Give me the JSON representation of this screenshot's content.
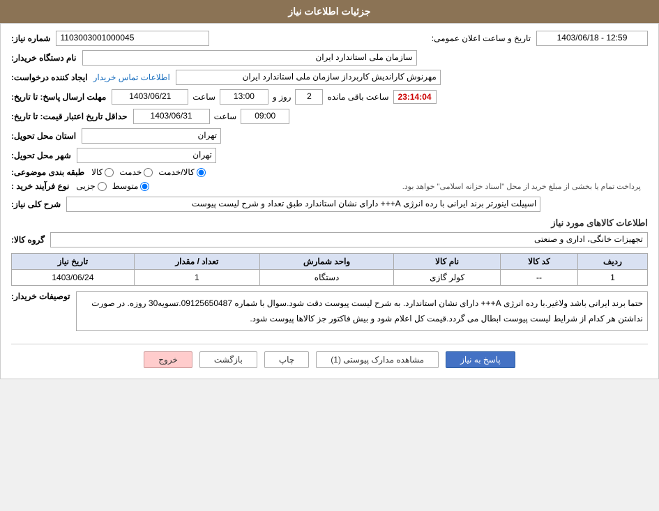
{
  "header": {
    "title": "جزئیات اطلاعات نیاز"
  },
  "form": {
    "shomareNiaz_label": "شماره نیاز:",
    "shomareNiaz_value": "1103003001000045",
    "namDastgah_label": "نام دستگاه خریدار:",
    "namDastgah_value": "سازمان ملی استاندارد ایران",
    "tarikhoSaat_label": "تاریخ و ساعت اعلان عمومی:",
    "tarikhoSaat_value": "1403/06/18 - 12:59",
    "ijadKonande_label": "ایجاد کننده درخواست:",
    "ijadKonande_value": "مهرنوش کاراندیش کاربرداز سازمان ملی استاندارد ایران",
    "ijadKonande_link": "اطلاعات تماس خریدار",
    "mohlatErsalLabel": "مهلت ارسال پاسخ: تا تاریخ:",
    "mohlatErsal_date": "1403/06/21",
    "mohlatErsal_saat_label": "ساعت",
    "mohlatErsal_saat": "13:00",
    "mohlatErsal_rooz_label": "روز و",
    "mohlatErsal_rooz": "2",
    "mohlatErsal_remaining_label": "ساعت باقی مانده",
    "mohlatErsal_timer": "23:14:04",
    "hadaqalTarikh_label": "حداقل تاریخ اعتبار قیمت: تا تاریخ:",
    "hadaqalTarikh_date": "1403/06/31",
    "hadaqalTarikh_saat_label": "ساعت",
    "hadaqalTarikh_saat": "09:00",
    "ostanLabel": "استان محل تحویل:",
    "ostan_value": "تهران",
    "shahrLabel": "شهر محل تحویل:",
    "shahr_value": "تهران",
    "tabaqebandiLabel": "طبقه بندی موضوعی:",
    "tabaqebandi_options": [
      {
        "label": "کالا",
        "value": "kala"
      },
      {
        "label": "خدمت",
        "value": "khedmat"
      },
      {
        "label": "کالا/خدمت",
        "value": "kala_khedmat",
        "selected": true
      }
    ],
    "noeFarayandLabel": "نوع فرآیند خرید :",
    "noeFarayand_options": [
      {
        "label": "جزیی",
        "value": "jozi"
      },
      {
        "label": "متوسط",
        "value": "motavaset",
        "selected": true
      }
    ],
    "noeFarayand_desc": "پرداخت تمام یا بخشی از مبلغ خرید از محل \"اسناد خزانه اسلامی\" خواهد بود.",
    "sharhKolli_label": "شرح کلی نیاز:",
    "sharhKolli_value": "اسپیلت اینورتر برند ایرانی با رده انرژی A+++ دارای نشان استاندارد طبق تعداد و شرح لیست پیوست",
    "ettelaatKalaLabel": "اطلاعات کالاهای مورد نیاز",
    "groupKalaLabel": "گروه کالا:",
    "groupKala_value": "تجهیزات خانگی، اداری و صنعتی",
    "table": {
      "columns": [
        "ردیف",
        "کد کالا",
        "نام کالا",
        "واحد شمارش",
        "تعداد / مقدار",
        "تاریخ نیاز"
      ],
      "rows": [
        {
          "radif": "1",
          "kodKala": "--",
          "namKala": "کولر گازی",
          "vahedShomareh": "دستگاه",
          "tedad": "1",
          "tarikh": "1403/06/24"
        }
      ]
    },
    "tosaifatLabel": "توصیفات خریدار:",
    "tosaifat_value": "حتما برند ایرانی باشد ولاغیر.با رده انرژی A+++ دارای نشان استاندارد. به شرح لیست پیوست دقت شود.سوال با شماره 09125650487.تسویه30 روزه. در صورت نداشتن هر کدام از شرایط لیست پیوست ابطال می گردد.قیمت کل اعلام شود و بیش فاکتور جز کالاها پیوست شود.",
    "buttons": {
      "pasakh": "پاسخ به نیاز",
      "moshahede": "مشاهده مدارک پیوستی (1)",
      "chap": "چاپ",
      "bazgasht": "بازگشت",
      "khorooj": "خروج"
    }
  }
}
